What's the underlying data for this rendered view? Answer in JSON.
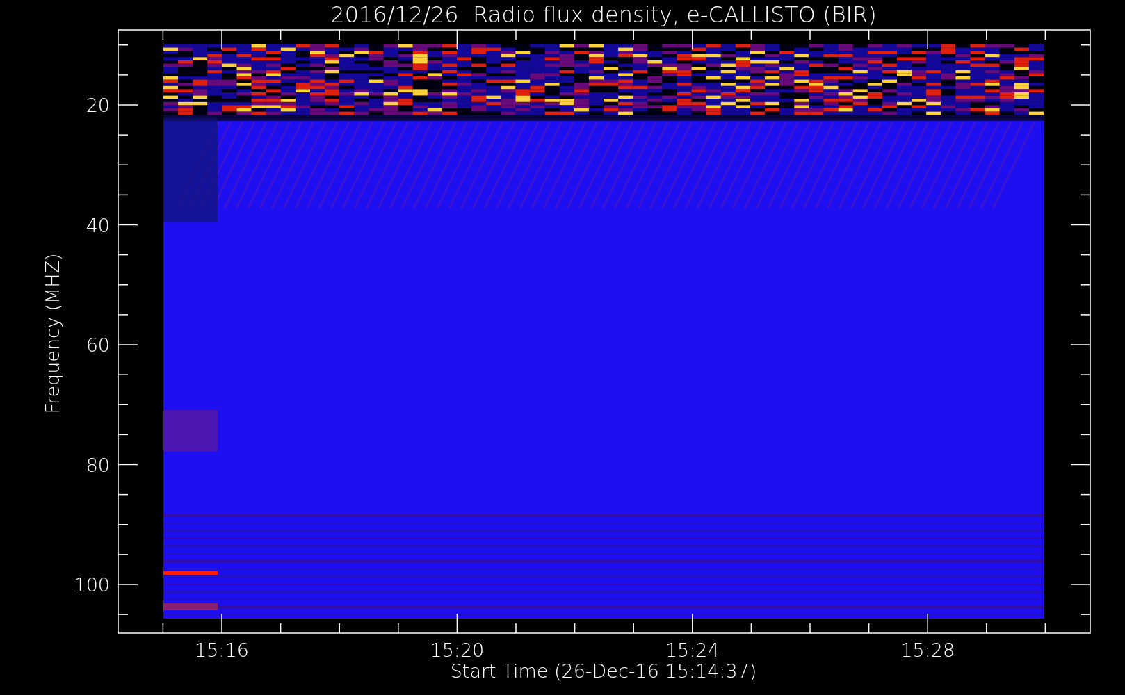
{
  "title": "2016/12/26  Radio flux density, e-CALLISTO (BIR)",
  "y_axis": {
    "label": "Frequency (MHZ)",
    "ticks": [
      "20",
      "40",
      "60",
      "80",
      "100"
    ]
  },
  "x_axis": {
    "label": "Start Time (26-Dec-16 15:14:37)",
    "ticks": [
      "15:16",
      "15:20",
      "15:24",
      "15:28"
    ]
  }
}
